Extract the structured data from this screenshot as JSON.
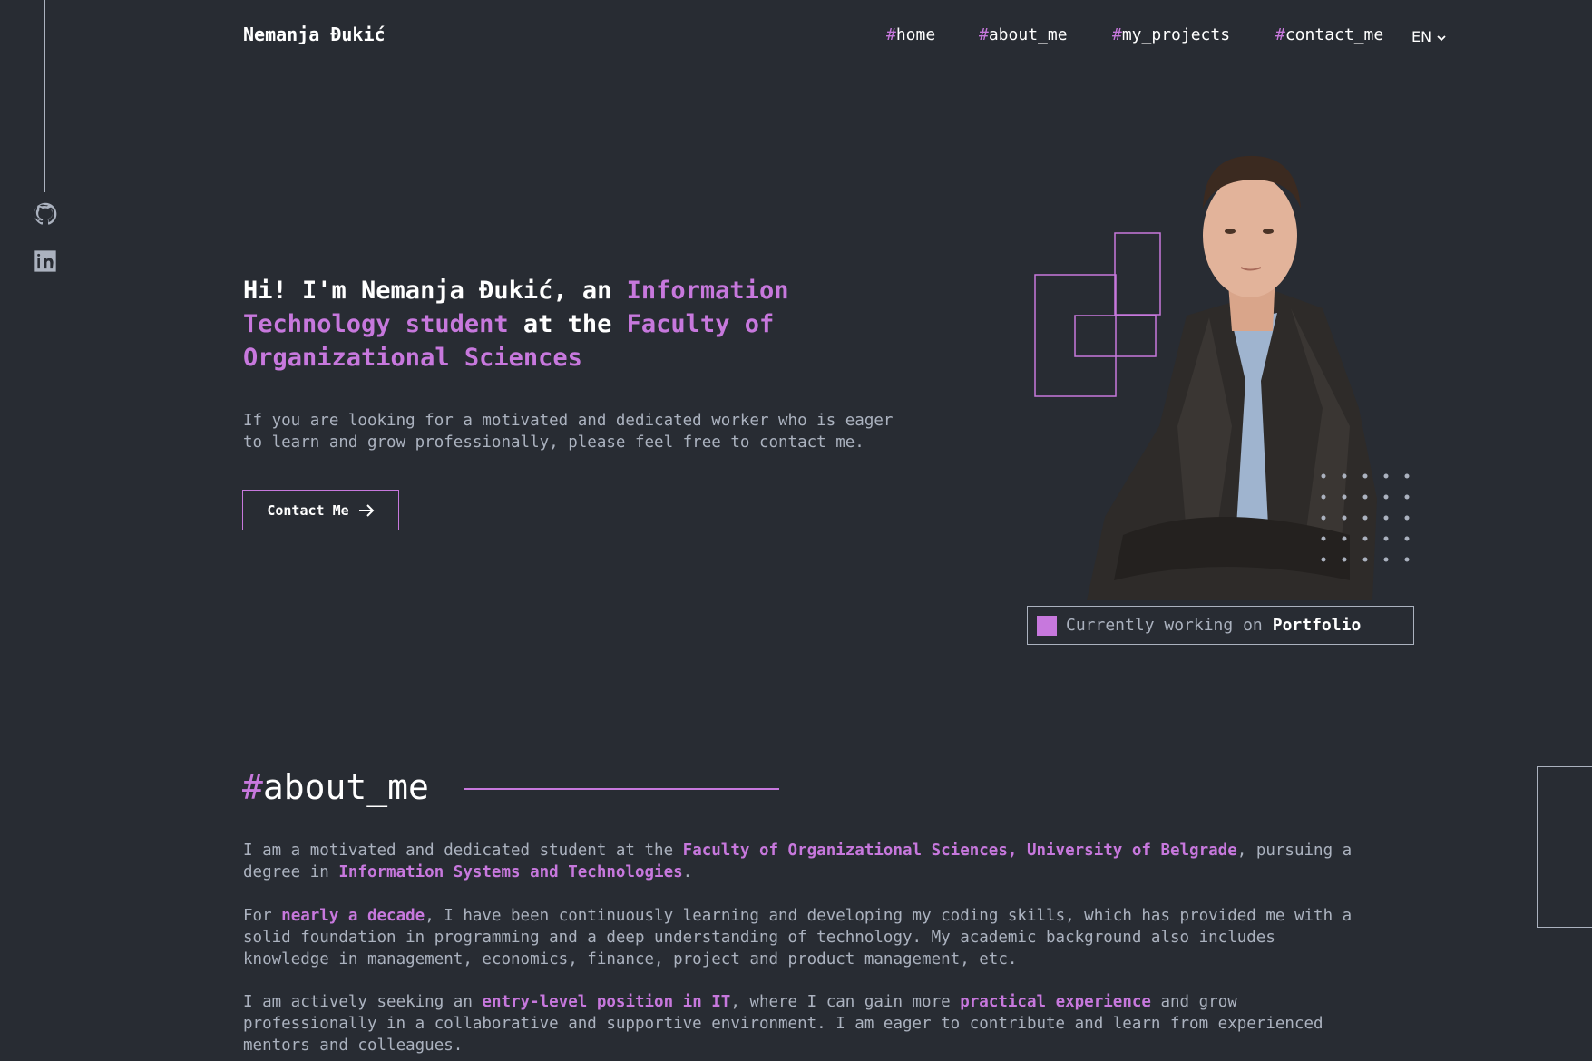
{
  "header": {
    "logo": "Nemanja Đukić",
    "nav": [
      {
        "hash": "#",
        "label": "home"
      },
      {
        "hash": "#",
        "label": "about_me"
      },
      {
        "hash": "#",
        "label": "my_projects"
      },
      {
        "hash": "#",
        "label": "contact_me"
      }
    ],
    "language": "EN"
  },
  "sidebar": {
    "icons": [
      "github-icon",
      "linkedin-icon"
    ]
  },
  "hero": {
    "title_parts": [
      {
        "text": "Hi! I'm Nemanja Đukić, an ",
        "accent": false
      },
      {
        "text": "Information Technology student",
        "accent": true
      },
      {
        "text": " at the ",
        "accent": false
      },
      {
        "text": "Faculty of Organizational Sciences",
        "accent": true
      }
    ],
    "subtitle": "If you are looking for a motivated and dedicated worker who is eager\nto learn and grow professionally, please feel free to contact me.",
    "button_label": "Contact Me",
    "status": {
      "prefix": "Currently working on",
      "project": "Portfolio"
    }
  },
  "about": {
    "hash": "#",
    "title": "about_me",
    "paragraphs": [
      [
        {
          "text": "I am a motivated and dedicated student at the ",
          "bold": false
        },
        {
          "text": "Faculty of Organizational Sciences, University of Belgrade",
          "bold": true
        },
        {
          "text": ", pursuing a degree in ",
          "bold": false
        },
        {
          "text": "Information Systems and Technologies",
          "bold": true
        },
        {
          "text": ".",
          "bold": false
        }
      ],
      [
        {
          "text": "For ",
          "bold": false
        },
        {
          "text": "nearly a decade",
          "bold": true
        },
        {
          "text": ", I have been continuously learning and developing my coding skills, which has provided me with a solid foundation in programming and a deep understanding of technology. My academic background also includes knowledge in management, economics, finance, project and product management, etc.",
          "bold": false
        }
      ],
      [
        {
          "text": "I am actively seeking an ",
          "bold": false
        },
        {
          "text": "entry-level position in IT",
          "bold": true
        },
        {
          "text": ", where I can gain more ",
          "bold": false
        },
        {
          "text": "practical experience",
          "bold": true
        },
        {
          "text": " and grow professionally in a collaborative and supportive environment. I am eager to contribute and learn from experienced mentors and colleagues.",
          "bold": false
        }
      ]
    ]
  },
  "colors": {
    "background": "#282c33",
    "accent": "#c778dd",
    "text": "#abb2bf",
    "heading": "#ffffff"
  }
}
